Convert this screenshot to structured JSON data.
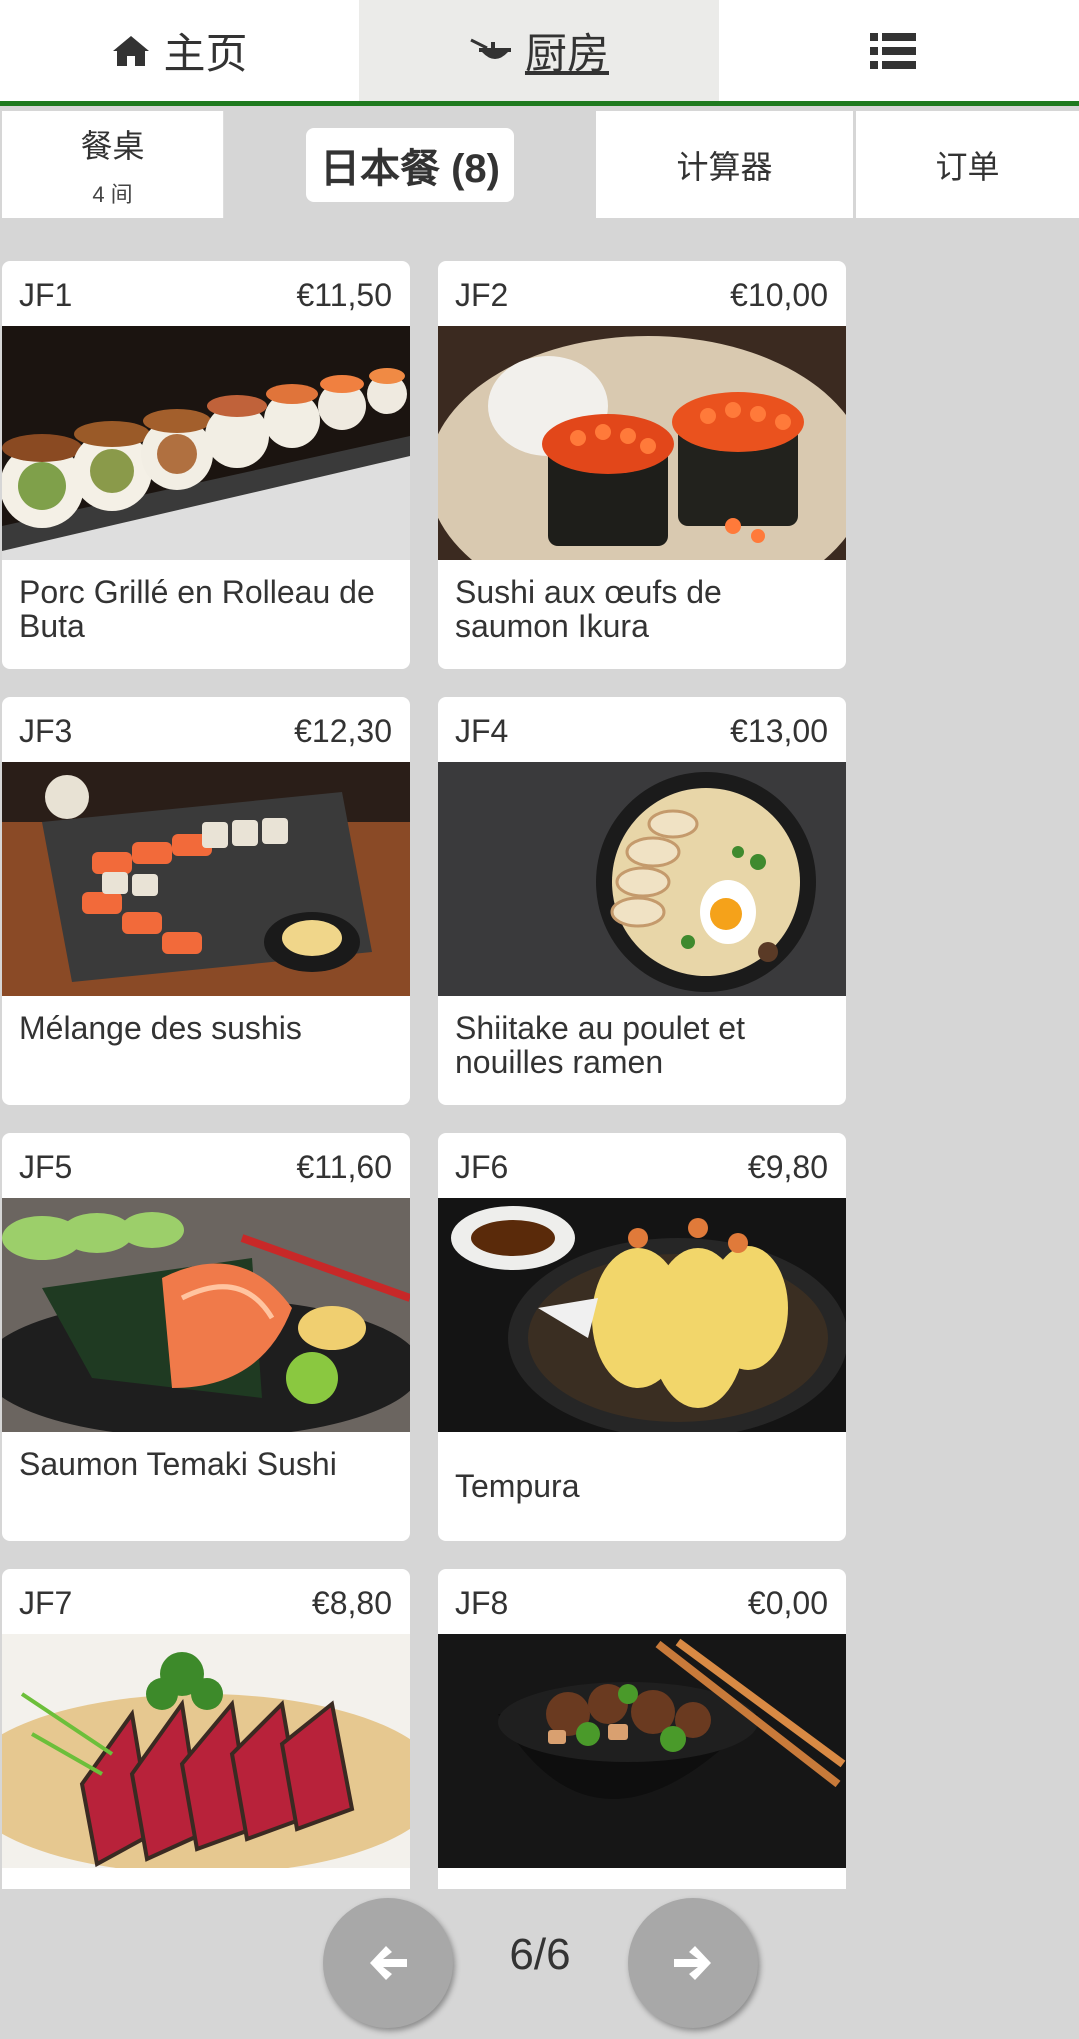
{
  "topnav": {
    "home_label": "主页",
    "kitchen_label": "厨房",
    "menu_icon": "list-icon"
  },
  "subtabs": {
    "tables_label": "餐桌",
    "tables_count": "4 间",
    "active_label": "日本餐 (8)",
    "calculator_label": "计算器",
    "orders_label": "订单"
  },
  "items": [
    {
      "code": "JF1",
      "price": "€11,50",
      "name": "Porc Grillé en Rolleau de Buta",
      "photo": "sushi-roll-photo"
    },
    {
      "code": "JF2",
      "price": "€10,00",
      "name": "Sushi aux œufs de saumon Ikura",
      "photo": "ikura-sushi-photo"
    },
    {
      "code": "JF3",
      "price": "€12,30",
      "name": "Mélange des sushis",
      "photo": "sushi-platter-photo"
    },
    {
      "code": "JF4",
      "price": "€13,00",
      "name": "Shiitake au poulet et nouilles ramen",
      "photo": "ramen-photo"
    },
    {
      "code": "JF5",
      "price": "€11,60",
      "name": "Saumon Temaki Sushi",
      "photo": "temaki-photo"
    },
    {
      "code": "JF6",
      "price": "€9,80",
      "name": "Tempura",
      "photo": "tempura-photo"
    },
    {
      "code": "JF7",
      "price": "€8,80",
      "name": "",
      "photo": "tuna-tataki-photo"
    },
    {
      "code": "JF8",
      "price": "€0,00",
      "name": "",
      "photo": "beef-bowl-photo"
    }
  ],
  "pager": {
    "label": "6/6",
    "prev_icon": "arrow-left-icon",
    "next_icon": "arrow-right-icon"
  },
  "colors": {
    "accent": "#1f7a1f",
    "background": "#d6d6d6",
    "button": "#a8a8a8"
  }
}
